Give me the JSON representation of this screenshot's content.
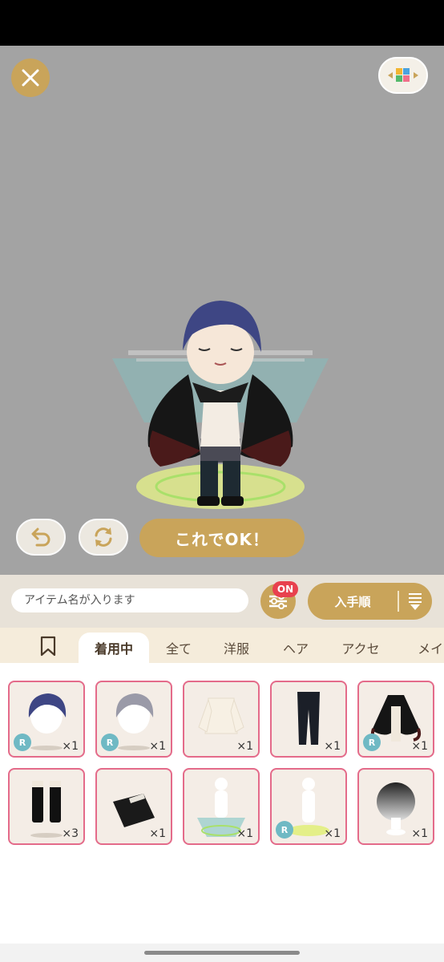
{
  "ok_button": {
    "label": "これでOK！"
  },
  "search": {
    "placeholder": "アイテム名が入ります"
  },
  "filter": {
    "badge": "ON"
  },
  "sort": {
    "label": "入手順"
  },
  "tabs": [
    {
      "label": "着用中",
      "active": true
    },
    {
      "label": "全て"
    },
    {
      "label": "洋服"
    },
    {
      "label": "ヘア"
    },
    {
      "label": "アクセ"
    },
    {
      "label": "メイク"
    }
  ],
  "items": [
    {
      "name": "dark-blue-hair",
      "rarity": "R",
      "count": "×1"
    },
    {
      "name": "gray-hair",
      "rarity": "R",
      "count": "×1"
    },
    {
      "name": "ruffle-blouse",
      "rarity": "",
      "count": "×1"
    },
    {
      "name": "black-pants",
      "rarity": "",
      "count": "×1"
    },
    {
      "name": "black-cape",
      "rarity": "R",
      "count": "×1"
    },
    {
      "name": "black-boots",
      "rarity": "",
      "count": "×3"
    },
    {
      "name": "black-book",
      "rarity": "",
      "count": "×1"
    },
    {
      "name": "teal-light-effect",
      "rarity": "",
      "count": "×1"
    },
    {
      "name": "magic-circle-effect",
      "rarity": "R",
      "count": "×1"
    },
    {
      "name": "gradient-hair",
      "rarity": "",
      "count": "×1"
    }
  ],
  "colors": {
    "gold": "#c9a45a",
    "stage": "#a3a3a3",
    "badge_red": "#e8414e",
    "rarity_teal": "#6fb9c4",
    "card_border": "#e46b8a"
  }
}
